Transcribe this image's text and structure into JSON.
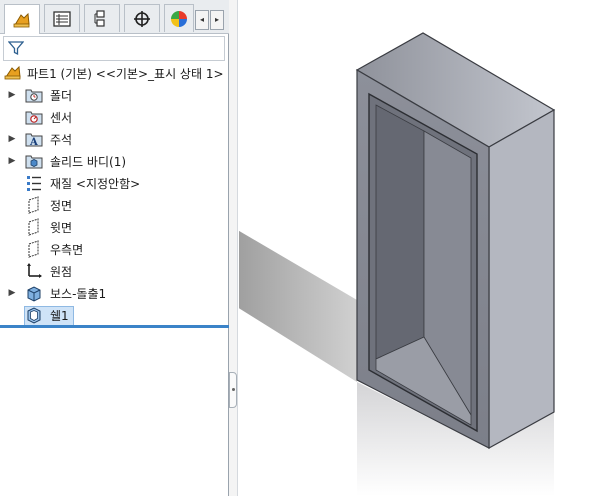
{
  "tabs": [
    {
      "name": "featuremanager",
      "icon": "featuremanager-icon",
      "active": true
    },
    {
      "name": "propertymanager",
      "icon": "propertymanager-icon",
      "active": false
    },
    {
      "name": "configurationmanager",
      "icon": "configurationmanager-icon",
      "active": false
    },
    {
      "name": "dimxpertmanager",
      "icon": "dimxpertmanager-icon",
      "active": false
    },
    {
      "name": "displaymanager",
      "icon": "displaymanager-icon",
      "active": false
    }
  ],
  "tab_scroll": {
    "left": "◂",
    "right": "▸"
  },
  "filter": {
    "icon": "funnel-icon"
  },
  "tree": {
    "root": {
      "label": "파트1 (기본) <<기본>_표시 상태 1>",
      "icon": "part-icon"
    },
    "items": [
      {
        "label": "폴더",
        "icon": "history-folder-icon",
        "expandable": true
      },
      {
        "label": "센서",
        "icon": "sensor-icon",
        "expandable": false
      },
      {
        "label": "주석",
        "icon": "annotation-icon",
        "expandable": true
      },
      {
        "label": "솔리드 바디(1)",
        "icon": "solid-body-icon",
        "expandable": true
      },
      {
        "label": "재질 <지정안함>",
        "icon": "material-icon",
        "expandable": false
      },
      {
        "label": "정면",
        "icon": "plane-icon",
        "expandable": false
      },
      {
        "label": "윗면",
        "icon": "plane-icon",
        "expandable": false
      },
      {
        "label": "우측면",
        "icon": "plane-icon",
        "expandable": false
      },
      {
        "label": "원점",
        "icon": "origin-icon",
        "expandable": false
      },
      {
        "label": "보스-돌출1",
        "icon": "extrude-icon",
        "expandable": true
      },
      {
        "label": "쉘1",
        "icon": "shell-icon",
        "expandable": false,
        "selected": true
      }
    ]
  },
  "colors": {
    "accent": "#3b83c8",
    "selection": "#cfe3f7",
    "model_front": "#8a8d97",
    "model_top": "#a9acb5",
    "model_side": "#b8bbc4"
  }
}
